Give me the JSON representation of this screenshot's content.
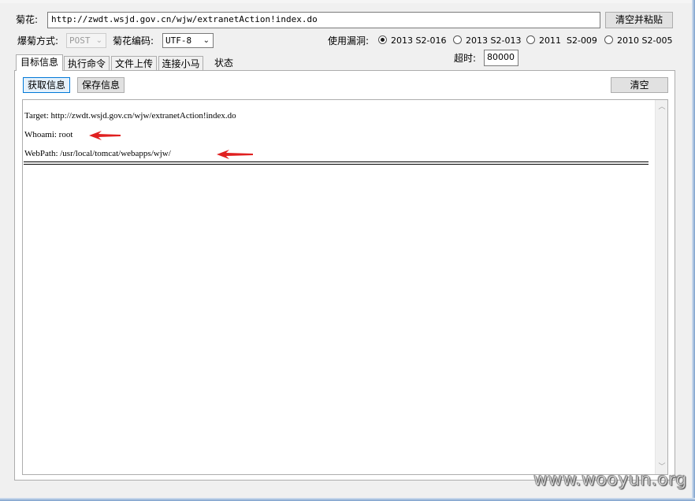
{
  "top": {
    "url_label": "菊花:",
    "url_value": "http://zwdt.wsjd.gov.cn/wjw/extranetAction!index.do",
    "clear_paste_label": "清空并粘贴"
  },
  "options": {
    "method_label": "爆菊方式:",
    "method_value": "POST",
    "encoding_label": "菊花编码:",
    "encoding_value": "UTF-8",
    "vuln_label": "使用漏洞:",
    "vulns": [
      {
        "label": "2013 S2-016",
        "checked": true
      },
      {
        "label": "2013 S2-013",
        "checked": false
      },
      {
        "label": "2011  S2-009",
        "checked": false
      },
      {
        "label": "2010 S2-005",
        "checked": false
      }
    ],
    "timeout_label": "超时:",
    "timeout_value": "80000"
  },
  "tabs": [
    {
      "label": "目标信息",
      "active": true
    },
    {
      "label": "执行命令",
      "active": false
    },
    {
      "label": "文件上传",
      "active": false
    },
    {
      "label": "连接小马",
      "active": false
    },
    {
      "label": "状态",
      "active": false
    }
  ],
  "panel": {
    "get_info_label": "获取信息",
    "save_info_label": "保存信息",
    "clear_label": "清空",
    "output": {
      "target": "Target: http://zwdt.wsjd.gov.cn/wjw/extranetAction!index.do",
      "whoami": "Whoami: root",
      "webpath": "WebPath: /usr/local/tomcat/webapps/wjw/"
    }
  },
  "scroll_up_icon": "scroll-up-arrow",
  "scroll_down_icon": "scroll-down-arrow",
  "arrow_color": "#e02020",
  "watermark": "www.wooyun.org"
}
